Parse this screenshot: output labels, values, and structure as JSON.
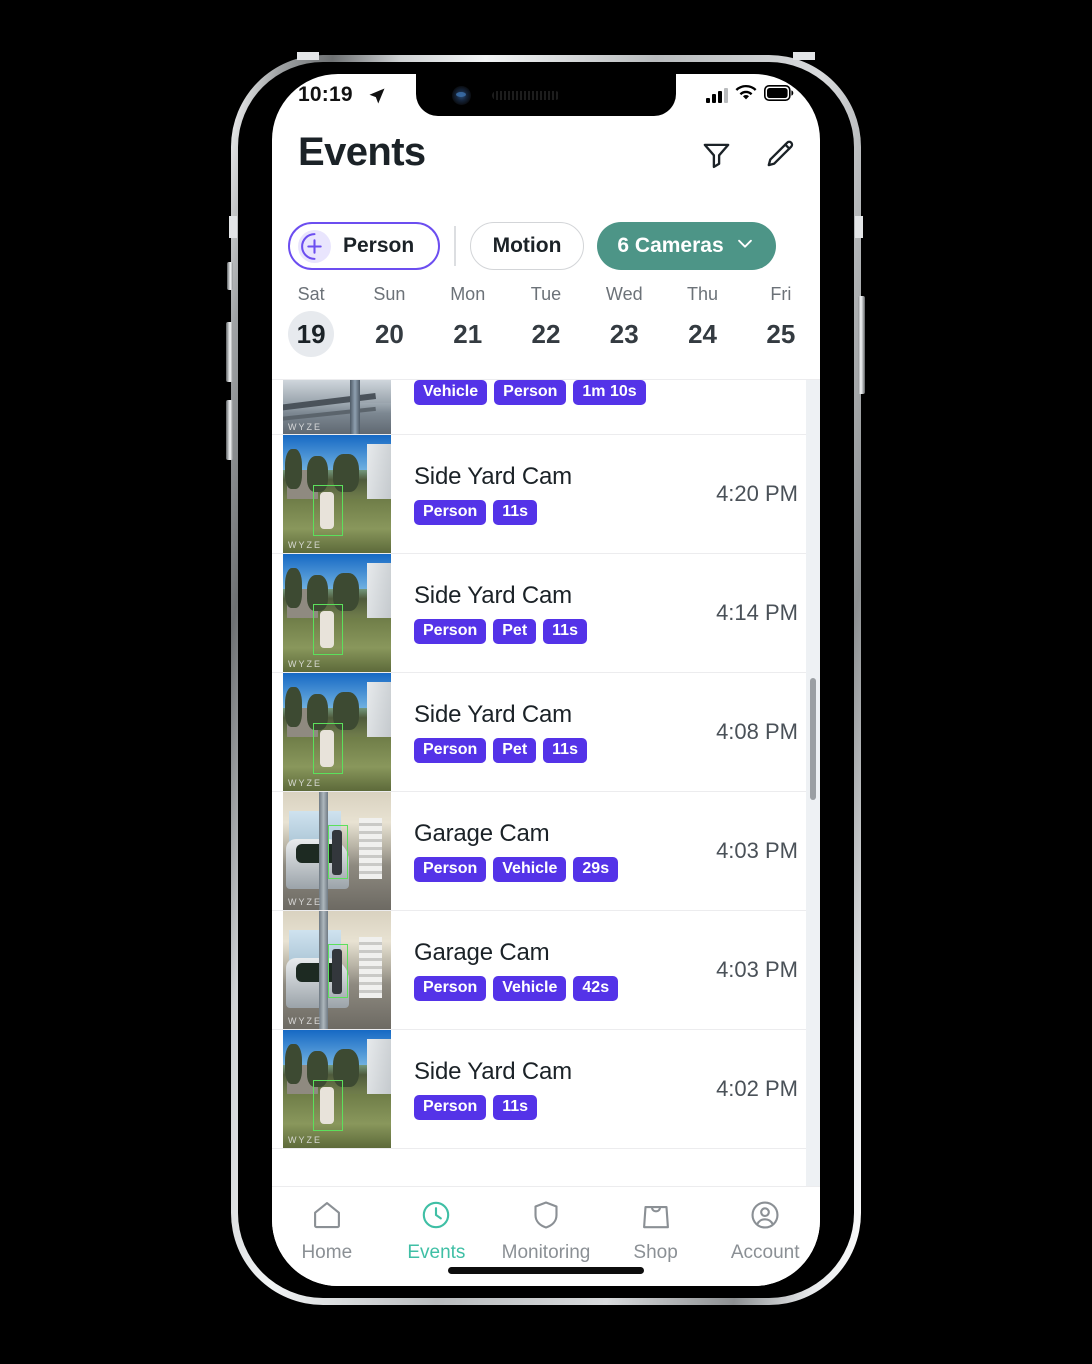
{
  "status_bar": {
    "time": "10:19",
    "location_icon": "location-arrow-icon",
    "signal_icon": "cellular-signal-icon",
    "wifi_icon": "wifi-icon",
    "battery_icon": "battery-icon"
  },
  "header": {
    "title": "Events",
    "filter_icon": "filter-funnel-icon",
    "edit_icon": "pencil-edit-icon"
  },
  "filters": {
    "person_chip": "Person",
    "person_icon": "plus-circle-icon",
    "motion_chip": "Motion",
    "cameras_chip": "6 Cameras",
    "cameras_chevron": "chevron-down-icon",
    "accent_purple": "#6c4ef0",
    "accent_teal": "#4d9587"
  },
  "date_strip": {
    "days": [
      {
        "dow": "Sat",
        "num": "19",
        "selected": true
      },
      {
        "dow": "Sun",
        "num": "20",
        "selected": false
      },
      {
        "dow": "Mon",
        "num": "21",
        "selected": false
      },
      {
        "dow": "Tue",
        "num": "22",
        "selected": false
      },
      {
        "dow": "Wed",
        "num": "23",
        "selected": false
      },
      {
        "dow": "Thu",
        "num": "24",
        "selected": false
      },
      {
        "dow": "Fri",
        "num": "25",
        "selected": false
      }
    ]
  },
  "events": [
    {
      "camera": "",
      "tags": [
        "Vehicle",
        "Person",
        "1m 10s"
      ],
      "time": "",
      "scene": "car",
      "watermark": "WYZE",
      "partial": true
    },
    {
      "camera": "Side Yard Cam",
      "tags": [
        "Person",
        "11s"
      ],
      "time": "4:20 PM",
      "scene": "yard",
      "watermark": "WYZE",
      "partial": false
    },
    {
      "camera": "Side Yard Cam",
      "tags": [
        "Person",
        "Pet",
        "11s"
      ],
      "time": "4:14 PM",
      "scene": "yard",
      "watermark": "WYZE",
      "partial": false
    },
    {
      "camera": "Side Yard Cam",
      "tags": [
        "Person",
        "Pet",
        "11s"
      ],
      "time": "4:08 PM",
      "scene": "yard",
      "watermark": "WYZE",
      "partial": false
    },
    {
      "camera": "Garage Cam",
      "tags": [
        "Person",
        "Vehicle",
        "29s"
      ],
      "time": "4:03 PM",
      "scene": "garage",
      "watermark": "WYZE",
      "partial": false
    },
    {
      "camera": "Garage Cam",
      "tags": [
        "Person",
        "Vehicle",
        "42s"
      ],
      "time": "4:03 PM",
      "scene": "garage",
      "watermark": "WYZE",
      "partial": false
    },
    {
      "camera": "Side Yard Cam",
      "tags": [
        "Person",
        "11s"
      ],
      "time": "4:02 PM",
      "scene": "yard",
      "watermark": "WYZE",
      "partial": false
    }
  ],
  "bottom_nav": {
    "items": [
      {
        "label": "Home",
        "icon": "home-icon",
        "active": false
      },
      {
        "label": "Events",
        "icon": "clock-icon",
        "active": true
      },
      {
        "label": "Monitoring",
        "icon": "shield-icon",
        "active": false
      },
      {
        "label": "Shop",
        "icon": "shopping-bag-icon",
        "active": false
      },
      {
        "label": "Account",
        "icon": "account-circle-icon",
        "active": false
      }
    ],
    "active_color": "#3fbfa5",
    "inactive_color": "#8b9095"
  },
  "tag_color": "#5433e8"
}
